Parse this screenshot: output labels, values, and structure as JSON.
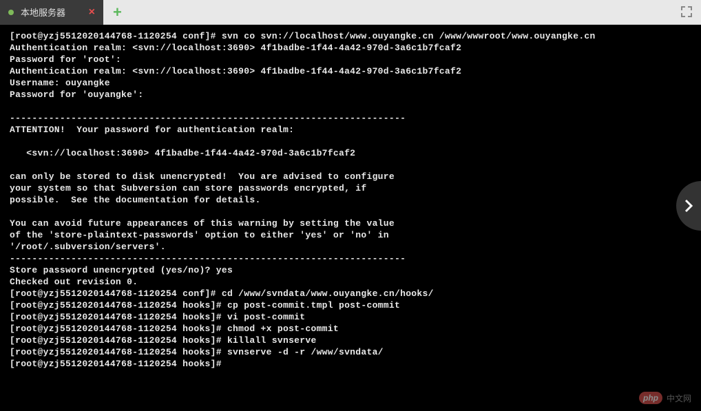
{
  "tab": {
    "label": "本地服务器",
    "close_symbol": "×"
  },
  "new_tab_symbol": "+",
  "terminal_lines": [
    "[root@yzj5512020144768-1120254 conf]# svn co svn://localhost/www.ouyangke.cn /www/wwwroot/www.ouyangke.cn",
    "Authentication realm: <svn://localhost:3690> 4f1badbe-1f44-4a42-970d-3a6c1b7fcaf2",
    "Password for 'root':",
    "Authentication realm: <svn://localhost:3690> 4f1badbe-1f44-4a42-970d-3a6c1b7fcaf2",
    "Username: ouyangke",
    "Password for 'ouyangke':",
    "",
    "-----------------------------------------------------------------------",
    "ATTENTION!  Your password for authentication realm:",
    "",
    "   <svn://localhost:3690> 4f1badbe-1f44-4a42-970d-3a6c1b7fcaf2",
    "",
    "can only be stored to disk unencrypted!  You are advised to configure",
    "your system so that Subversion can store passwords encrypted, if",
    "possible.  See the documentation for details.",
    "",
    "You can avoid future appearances of this warning by setting the value",
    "of the 'store-plaintext-passwords' option to either 'yes' or 'no' in",
    "'/root/.subversion/servers'.",
    "-----------------------------------------------------------------------",
    "Store password unencrypted (yes/no)? yes",
    "Checked out revision 0.",
    "[root@yzj5512020144768-1120254 conf]# cd /www/svndata/www.ouyangke.cn/hooks/",
    "[root@yzj5512020144768-1120254 hooks]# cp post-commit.tmpl post-commit",
    "[root@yzj5512020144768-1120254 hooks]# vi post-commit",
    "[root@yzj5512020144768-1120254 hooks]# chmod +x post-commit",
    "[root@yzj5512020144768-1120254 hooks]# killall svnserve",
    "[root@yzj5512020144768-1120254 hooks]# svnserve -d -r /www/svndata/",
    "[root@yzj5512020144768-1120254 hooks]#"
  ],
  "watermark": {
    "logo_text": "php",
    "label": "中文网"
  }
}
